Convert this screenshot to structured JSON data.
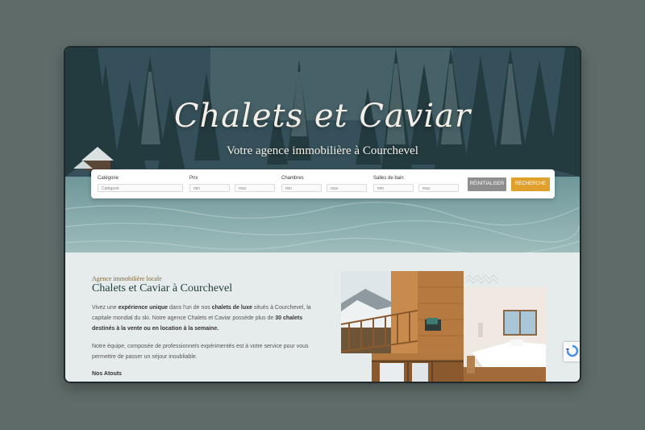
{
  "hero": {
    "title": "Chalets et Caviar",
    "subtitle": "Votre agence immobilière à Courchevel"
  },
  "search": {
    "category_label": "Catégorie",
    "category_placeholder": "Catégorie",
    "price_label": "Prix",
    "price_min": "min",
    "price_max": "max",
    "rooms_label": "Chambres",
    "rooms_min": "min",
    "rooms_max": "max",
    "baths_label": "Salles de bain",
    "baths_min": "min",
    "baths_max": "max",
    "reset_label": "RÉINITIALISER",
    "search_label": "RECHERCHE"
  },
  "about": {
    "kicker": "Agence immobilière locale",
    "heading": "Chalets et Caviar à Courchevel",
    "p1": {
      "t1": "Vivez une ",
      "b1": "expérience unique",
      "t2": " dans l'un de nos ",
      "b2": "chalets de luxe",
      "t3": " situés à Courchevel, la capitale mondial du ski. Notre agence Chalets et Caviar possède plus de ",
      "b3": "30 chalets destinés à la vente ou en location à la semaine."
    },
    "p2": "Notre équipe, composée de professionnels expérimentés est à votre service pour vous permettre de passer un séjour inoubliable.",
    "atouts": "Nos Atouts"
  },
  "colors": {
    "accent": "#e0a02c",
    "reset": "#8e8e8e",
    "heading": "#1f3c3f",
    "kicker": "#7d6840"
  }
}
